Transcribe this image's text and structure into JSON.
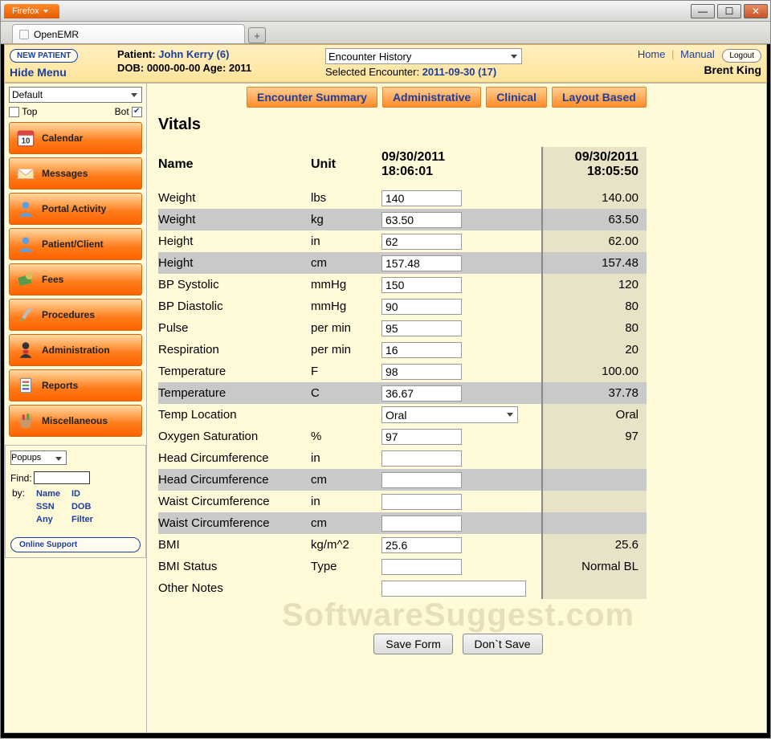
{
  "window": {
    "ff_label": "Firefox",
    "tab_title": "OpenEMR"
  },
  "topbar": {
    "new_patient": "NEW PATIENT",
    "hide_menu": "Hide Menu",
    "patient_label": "Patient:",
    "patient_link": "John Kerry (6)",
    "dob_line": "DOB: 0000-00-00 Age: 2011",
    "encounter_select": "Encounter History",
    "sel_enc_label": "Selected Encounter:",
    "sel_enc_value": "2011-09-30 (17)",
    "home": "Home",
    "manual": "Manual",
    "logout": "Logout",
    "username": "Brent King"
  },
  "sidebar": {
    "select": "Default",
    "top": "Top",
    "bot": "Bot",
    "items": [
      {
        "label": "Calendar"
      },
      {
        "label": "Messages"
      },
      {
        "label": "Portal Activity"
      },
      {
        "label": "Patient/Client"
      },
      {
        "label": "Fees"
      },
      {
        "label": "Procedures"
      },
      {
        "label": "Administration"
      },
      {
        "label": "Reports"
      },
      {
        "label": "Miscellaneous"
      }
    ],
    "popups": "Popups",
    "find_label": "Find:",
    "by_label": "by:",
    "by_links": {
      "name": "Name",
      "id": "ID",
      "ssn": "SSN",
      "dob": "DOB",
      "any": "Any",
      "filter": "Filter"
    },
    "support": "Online Support"
  },
  "main": {
    "tabs": [
      {
        "label": "Encounter Summary"
      },
      {
        "label": "Administrative"
      },
      {
        "label": "Clinical"
      },
      {
        "label": "Layout Based"
      }
    ],
    "title": "Vitals",
    "headers": {
      "name": "Name",
      "unit": "Unit",
      "ts_current": "09/30/2011 18:06:01",
      "ts_prev": "09/30/2011 18:05:50"
    },
    "rows": [
      {
        "name": "Weight",
        "unit": "lbs",
        "val": "140",
        "prev": "140.00",
        "shade": false
      },
      {
        "name": "Weight",
        "unit": "kg",
        "val": "63.50",
        "prev": "63.50",
        "shade": true
      },
      {
        "name": "Height",
        "unit": "in",
        "val": "62",
        "prev": "62.00",
        "shade": false
      },
      {
        "name": "Height",
        "unit": "cm",
        "val": "157.48",
        "prev": "157.48",
        "shade": true
      },
      {
        "name": "BP Systolic",
        "unit": "mmHg",
        "val": "150",
        "prev": "120",
        "shade": false
      },
      {
        "name": "BP Diastolic",
        "unit": "mmHg",
        "val": "90",
        "prev": "80",
        "shade": false
      },
      {
        "name": "Pulse",
        "unit": "per min",
        "val": "95",
        "prev": "80",
        "shade": false
      },
      {
        "name": "Respiration",
        "unit": "per min",
        "val": "16",
        "prev": "20",
        "shade": false
      },
      {
        "name": "Temperature",
        "unit": "F",
        "val": "98",
        "prev": "100.00",
        "shade": false
      },
      {
        "name": "Temperature",
        "unit": "C",
        "val": "36.67",
        "prev": "37.78",
        "shade": true
      },
      {
        "name": "Temp Location",
        "unit": "",
        "val": "Oral",
        "prev": "Oral",
        "shade": false,
        "select": true
      },
      {
        "name": "Oxygen Saturation",
        "unit": "%",
        "val": "97",
        "prev": "97",
        "shade": false
      },
      {
        "name": "Head Circumference",
        "unit": "in",
        "val": "",
        "prev": "",
        "shade": false
      },
      {
        "name": "Head Circumference",
        "unit": "cm",
        "val": "",
        "prev": "",
        "shade": true
      },
      {
        "name": "Waist Circumference",
        "unit": "in",
        "val": "",
        "prev": "",
        "shade": false
      },
      {
        "name": "Waist Circumference",
        "unit": "cm",
        "val": "",
        "prev": "",
        "shade": true
      },
      {
        "name": "BMI",
        "unit": "kg/m^2",
        "val": "25.6",
        "prev": "25.6",
        "shade": false
      },
      {
        "name": "BMI Status",
        "unit": "Type",
        "val": "",
        "prev": "Normal BL",
        "shade": false
      },
      {
        "name": "Other Notes",
        "unit": "",
        "val": "",
        "prev": "",
        "shade": false,
        "notes": true
      }
    ],
    "save": "Save Form",
    "dont": "Don`t Save",
    "watermark": "SoftwareSuggest.com"
  }
}
